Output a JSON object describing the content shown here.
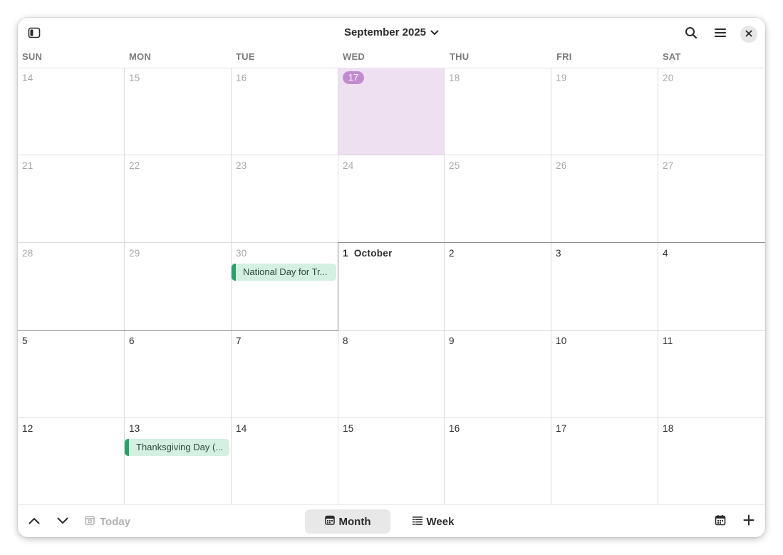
{
  "header": {
    "title": "September 2025",
    "icons": {
      "sidebar": "sidebar-toggle-icon",
      "title_chevron": "chevron-down-icon",
      "search": "search-icon",
      "menu": "hamburger-menu-icon",
      "close": "close-icon"
    }
  },
  "weekdays": [
    "SUN",
    "MON",
    "TUE",
    "WED",
    "THU",
    "FRI",
    "SAT"
  ],
  "weeks": [
    [
      "14",
      "15",
      "16",
      "17",
      "18",
      "19",
      "20"
    ],
    [
      "21",
      "22",
      "23",
      "24",
      "25",
      "26",
      "27"
    ],
    [
      "28",
      "29",
      "30",
      "1",
      "2",
      "3",
      "4"
    ],
    [
      "5",
      "6",
      "7",
      "8",
      "9",
      "10",
      "11"
    ],
    [
      "12",
      "13",
      "14",
      "15",
      "16",
      "17",
      "18"
    ]
  ],
  "month_label": "October",
  "today": "17",
  "events": {
    "national_day": "National Day for Tr...",
    "thanksgiving": "Thanksgiving Day (..."
  },
  "colors": {
    "today_background": "#eee0f1",
    "today_pill": "#c18bd0",
    "event_background": "#d4f0e3",
    "event_accent": "#27a465"
  },
  "footer": {
    "today_label": "Today",
    "month_label": "Month",
    "week_label": "Week",
    "icons": {
      "previous": "chevron-up-icon",
      "next": "chevron-down-icon",
      "today": "calendar-today-icon",
      "month": "calendar-month-icon",
      "week": "calendar-week-icon",
      "date_picker": "calendar-icon",
      "add": "plus-icon"
    }
  }
}
